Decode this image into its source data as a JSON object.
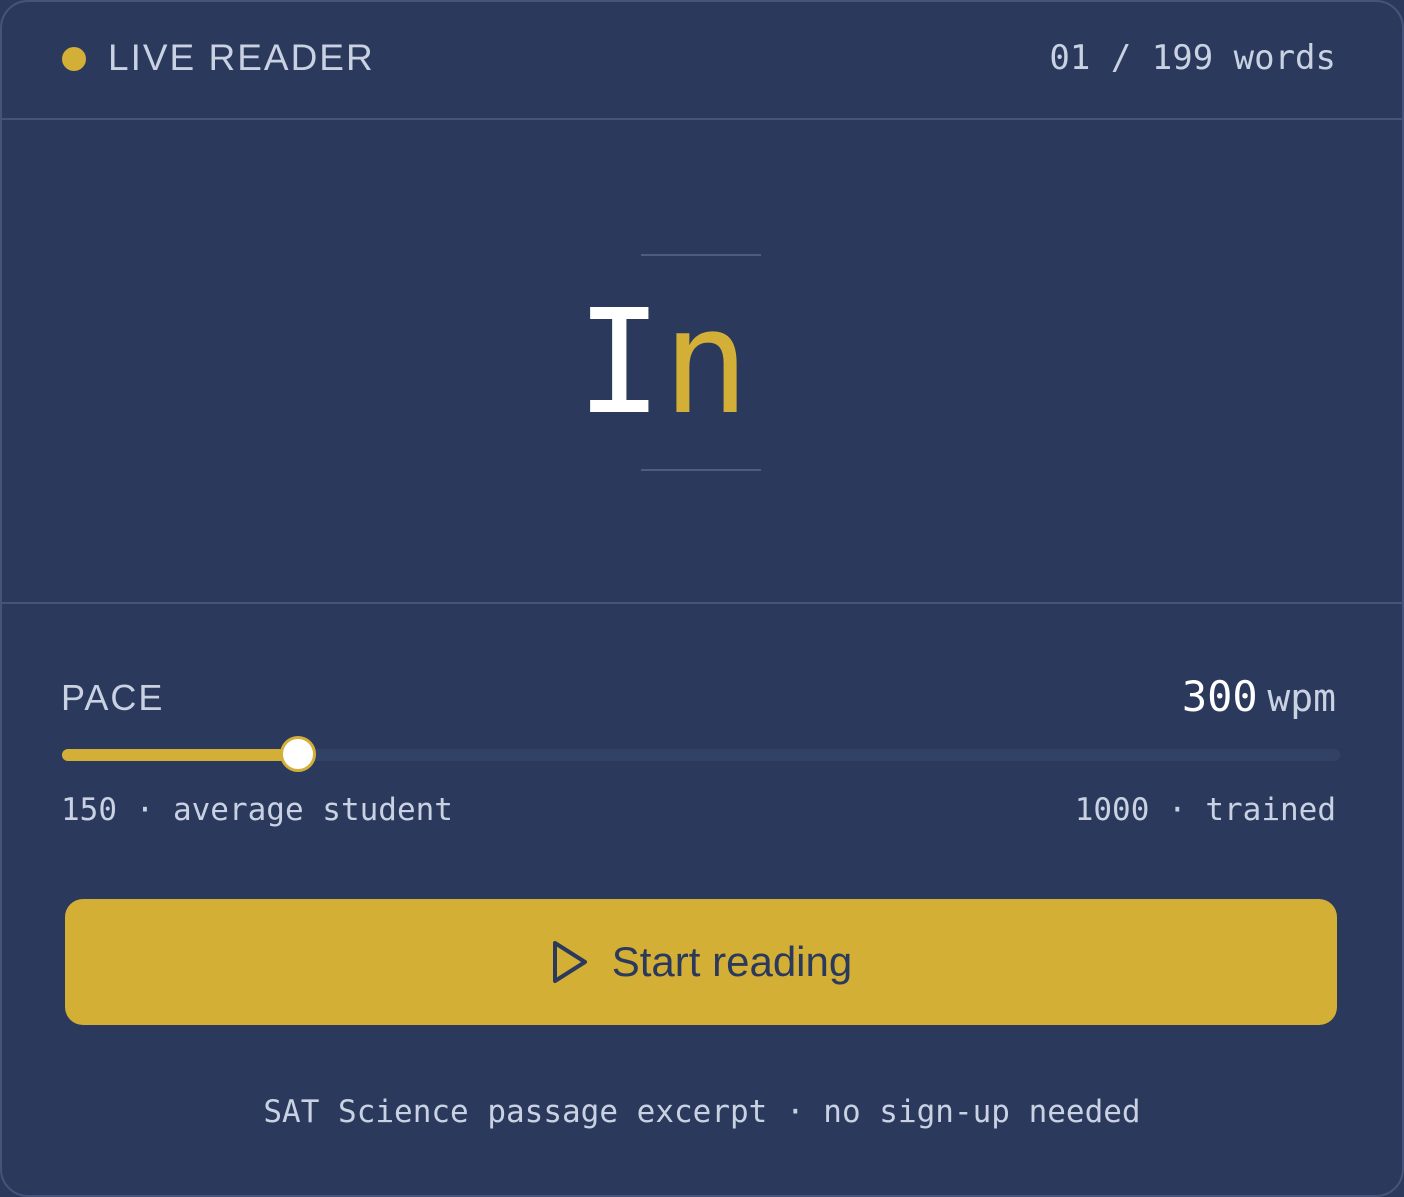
{
  "header": {
    "title": "LIVE READER",
    "word_count": "01 / 199 words"
  },
  "display": {
    "word_prefix": "I",
    "word_focus": "n"
  },
  "pace": {
    "label": "PACE",
    "value": "300",
    "unit": "wpm",
    "min_value": 150,
    "max_value": 1000,
    "current_value": 300,
    "fill_fraction": 0.185,
    "min_label": "150 · average student",
    "max_label": "1000 · trained"
  },
  "start_button": {
    "label": "Start reading",
    "icon": "play-icon"
  },
  "footer": {
    "note": "SAT Science passage excerpt · no sign-up needed"
  },
  "colors": {
    "background": "#2b3a5c",
    "accent": "#d4af37",
    "text": "#c9d1e3",
    "divider": "#45547a"
  }
}
